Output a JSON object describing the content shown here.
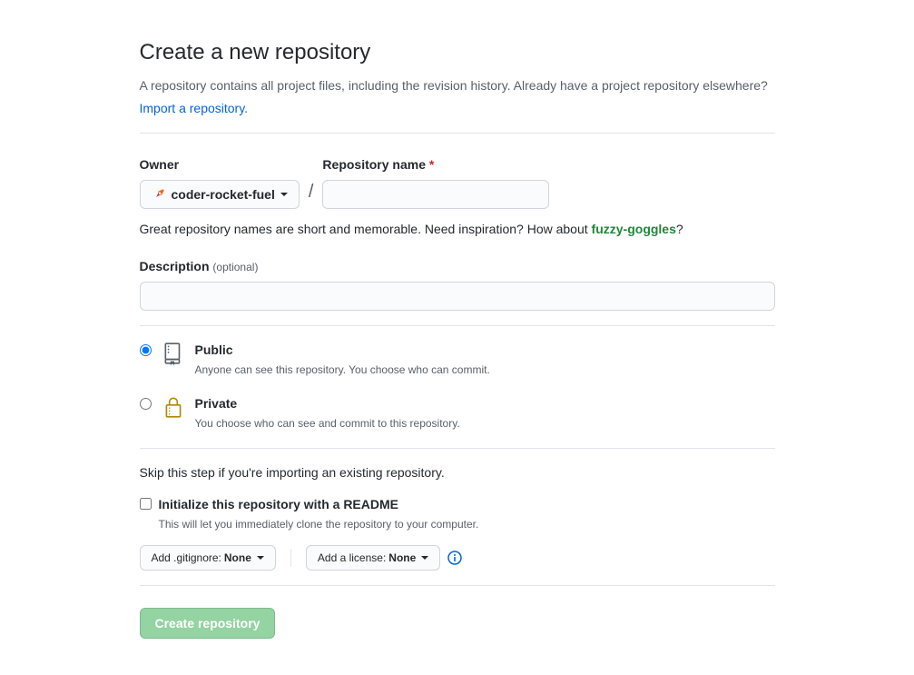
{
  "header": {
    "title": "Create a new repository",
    "subtitle": "A repository contains all project files, including the revision history. Already have a project repository elsewhere?",
    "import_link": "Import a repository."
  },
  "form": {
    "owner_label": "Owner",
    "owner_value": "coder-rocket-fuel",
    "repo_label": "Repository name",
    "repo_value": "",
    "slash": "/",
    "help_prefix": "Great repository names are short and memorable. Need inspiration? How about ",
    "help_suggestion": "fuzzy-goggles",
    "help_suffix": "?",
    "description_label": "Description",
    "description_optional": "(optional)",
    "description_value": ""
  },
  "visibility": {
    "public": {
      "title": "Public",
      "desc": "Anyone can see this repository. You choose who can commit."
    },
    "private": {
      "title": "Private",
      "desc": "You choose who can see and commit to this repository."
    }
  },
  "init": {
    "skip_text": "Skip this step if you're importing an existing repository.",
    "readme_title": "Initialize this repository with a README",
    "readme_desc": "This will let you immediately clone the repository to your computer.",
    "gitignore_label": "Add .gitignore:",
    "gitignore_value": "None",
    "license_label": "Add a license:",
    "license_value": "None"
  },
  "submit": {
    "create_label": "Create repository"
  }
}
